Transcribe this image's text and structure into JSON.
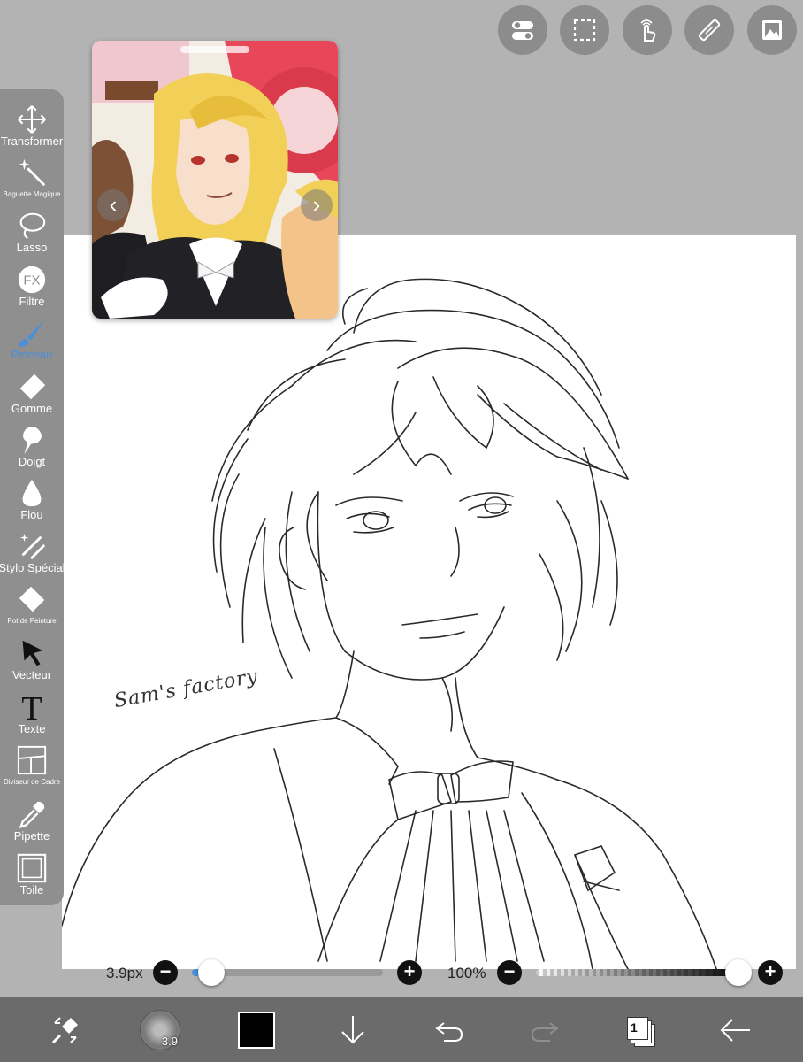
{
  "top_actions": [
    {
      "name": "toggle-icon"
    },
    {
      "name": "selection-icon"
    },
    {
      "name": "gesture-icon"
    },
    {
      "name": "ruler-icon"
    },
    {
      "name": "reference-image-icon"
    }
  ],
  "toolbar": {
    "tools": [
      {
        "label": "Transformer",
        "icon": "move-icon",
        "small": false
      },
      {
        "label": "Baguette Magique",
        "icon": "magic-wand-icon",
        "small": true
      },
      {
        "label": "Lasso",
        "icon": "lasso-icon",
        "small": false
      },
      {
        "label": "Filtre",
        "icon": "fx-icon",
        "small": false
      },
      {
        "label": "Pinceau",
        "icon": "brush-icon",
        "small": false,
        "active": true
      },
      {
        "label": "Gomme",
        "icon": "eraser-icon",
        "small": false
      },
      {
        "label": "Doigt",
        "icon": "smudge-icon",
        "small": false
      },
      {
        "label": "Flou",
        "icon": "blur-drop-icon",
        "small": false
      },
      {
        "label": "Stylo Spécial",
        "icon": "special-pen-icon",
        "small": false
      },
      {
        "label": "Pot de Peinture",
        "icon": "paint-bucket-icon",
        "small": true
      },
      {
        "label": "Vecteur",
        "icon": "vector-cursor-icon",
        "small": false
      },
      {
        "label": "Texte",
        "icon": "text-icon",
        "small": false
      },
      {
        "label": "Diviseur de Cadre",
        "icon": "frame-divider-icon",
        "small": true
      },
      {
        "label": "Pipette",
        "icon": "eyedropper-icon",
        "small": false
      },
      {
        "label": "Toile",
        "icon": "canvas-icon",
        "small": false
      }
    ],
    "active_color": "#4a8fd9"
  },
  "canvas": {
    "signature": "Sam's factory"
  },
  "sliders": {
    "brush_size": {
      "text": "3.9px",
      "value_fraction": 0.04
    },
    "opacity": {
      "text": "100%",
      "value_fraction": 1.0
    }
  },
  "bottombar": {
    "brush_size_badge": "3.9",
    "color": "#000000",
    "layer_count": "1"
  }
}
